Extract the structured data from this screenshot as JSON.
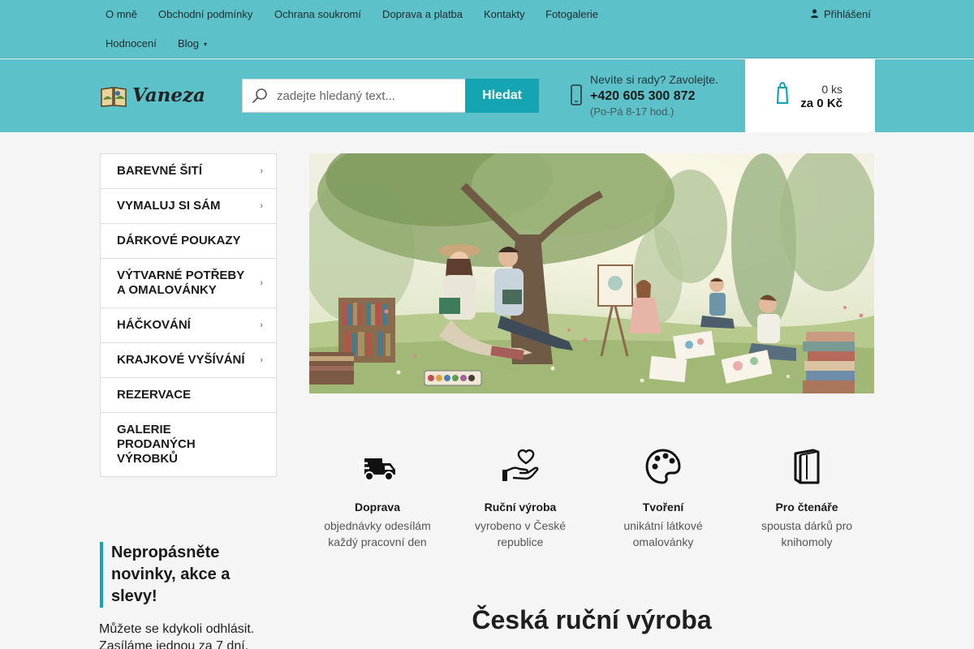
{
  "topnav": {
    "row1": [
      "O mně",
      "Obchodní podmínky",
      "Ochrana soukromí",
      "Doprava a platba",
      "Kontakty",
      "Fotogalerie"
    ],
    "row2": [
      "Hodnocení",
      "Blog"
    ],
    "login": "Přihlášení"
  },
  "header": {
    "logo_text": "Vaneza",
    "search_placeholder": "zadejte hledaný text...",
    "search_button": "Hledat",
    "help_text": "Nevíte si rady? Zavolejte.",
    "phone": "+420 605 300 872",
    "hours": "(Po-Pá 8-17 hod.)",
    "cart_count": "0 ks",
    "cart_total": "za 0 Kč"
  },
  "categories": [
    {
      "label": "BAREVNÉ ŠITÍ",
      "has_sub": true
    },
    {
      "label": "VYMALUJ SI SÁM",
      "has_sub": true
    },
    {
      "label": "DÁRKOVÉ POUKAZY",
      "has_sub": false
    },
    {
      "label": "VÝTVARNÉ POTŘEBY A OMALOVÁNKY",
      "has_sub": true
    },
    {
      "label": "HÁČKOVÁNÍ",
      "has_sub": true
    },
    {
      "label": "KRAJKOVÉ VYŠÍVÁNÍ",
      "has_sub": true
    },
    {
      "label": "REZERVACE",
      "has_sub": false
    },
    {
      "label": "GALERIE PRODANÝCH VÝROBKŮ",
      "has_sub": false
    }
  ],
  "newsletter": {
    "title": "Nepropásněte novinky, akce a slevy!",
    "text": "Můžete se kdykoli odhlásit. Zasíláme jednou za 7 dní."
  },
  "features": [
    {
      "icon": "truck-icon",
      "title": "Doprava",
      "desc": "objednávky odesílám každý pracovní den"
    },
    {
      "icon": "hand-heart-icon",
      "title": "Ruční výroba",
      "desc": "vyrobeno v České republice"
    },
    {
      "icon": "palette-icon",
      "title": "Tvoření",
      "desc": "unikátní látkové omalovánky"
    },
    {
      "icon": "book-icon",
      "title": "Pro čtenáře",
      "desc": "spousta dárků pro knihomoly"
    }
  ],
  "main_heading": "Česká ruční výroba",
  "colors": {
    "brand": "#5cc1c9",
    "accent": "#15a4b1"
  }
}
